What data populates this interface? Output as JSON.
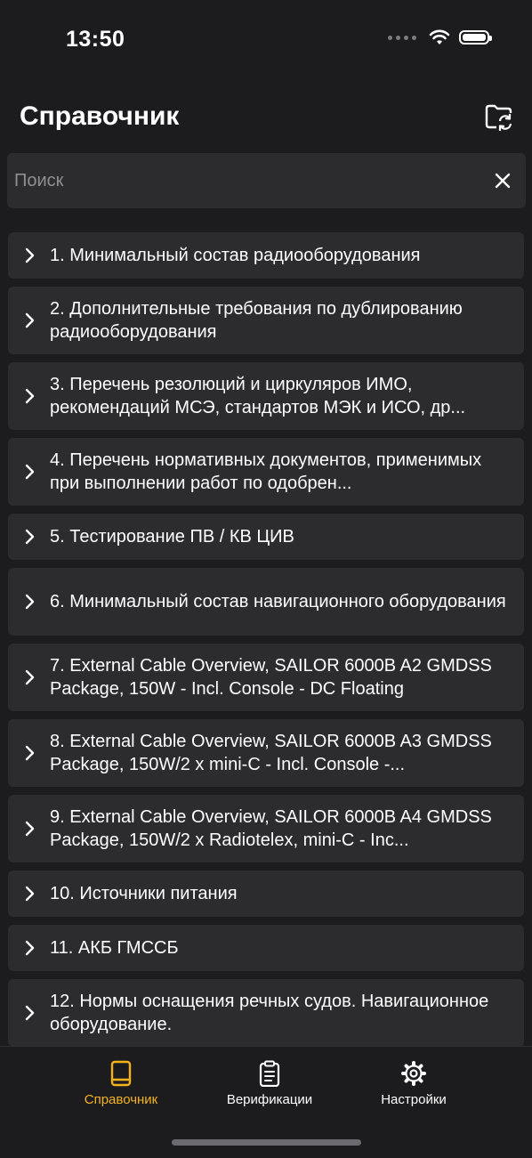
{
  "status_bar": {
    "time": "13:50"
  },
  "header": {
    "title": "Справочник"
  },
  "search": {
    "placeholder": "Поиск",
    "value": ""
  },
  "items": [
    {
      "label": "1. Минимальный состав радиооборудования"
    },
    {
      "label": "2. Дополнительные требования по дублированию радиооборудования"
    },
    {
      "label": "3. Перечень резолюций и циркуляров ИМО, рекомендаций МСЭ, стандартов МЭК и ИСО, др..."
    },
    {
      "label": "4. Перечень нормативных документов, применимых при выполнении работ по одобрен..."
    },
    {
      "label": "5. Тестирование ПВ / КВ ЦИВ"
    },
    {
      "label": "6. Минимальный состав навигационного оборудования"
    },
    {
      "label": "7. External Cable Overview, SAILOR 6000B A2 GMDSS Package, 150W - Incl. Console - DC Floating"
    },
    {
      "label": "8. External Cable Overview, SAILOR 6000B A3 GMDSS Package, 150W/2 x mini-C - Incl. Console -..."
    },
    {
      "label": "9. External Cable Overview, SAILOR 6000B A4 GMDSS Package, 150W/2 x Radiotelex, mini-C - Inc..."
    },
    {
      "label": "10. Источники питания"
    },
    {
      "label": "11. АКБ ГМССБ"
    },
    {
      "label": "12. Нормы оснащения речных судов. Навигационное оборудование."
    }
  ],
  "tabs": [
    {
      "label": "Справочник",
      "active": true,
      "icon": "book-icon"
    },
    {
      "label": "Верификации",
      "active": false,
      "icon": "clipboard-icon"
    },
    {
      "label": "Настройки",
      "active": false,
      "icon": "gear-icon"
    }
  ],
  "colors": {
    "accent": "#f5b31b",
    "background": "#1c1c1e",
    "card": "#2c2c2e",
    "placeholder": "#8e8e93"
  }
}
